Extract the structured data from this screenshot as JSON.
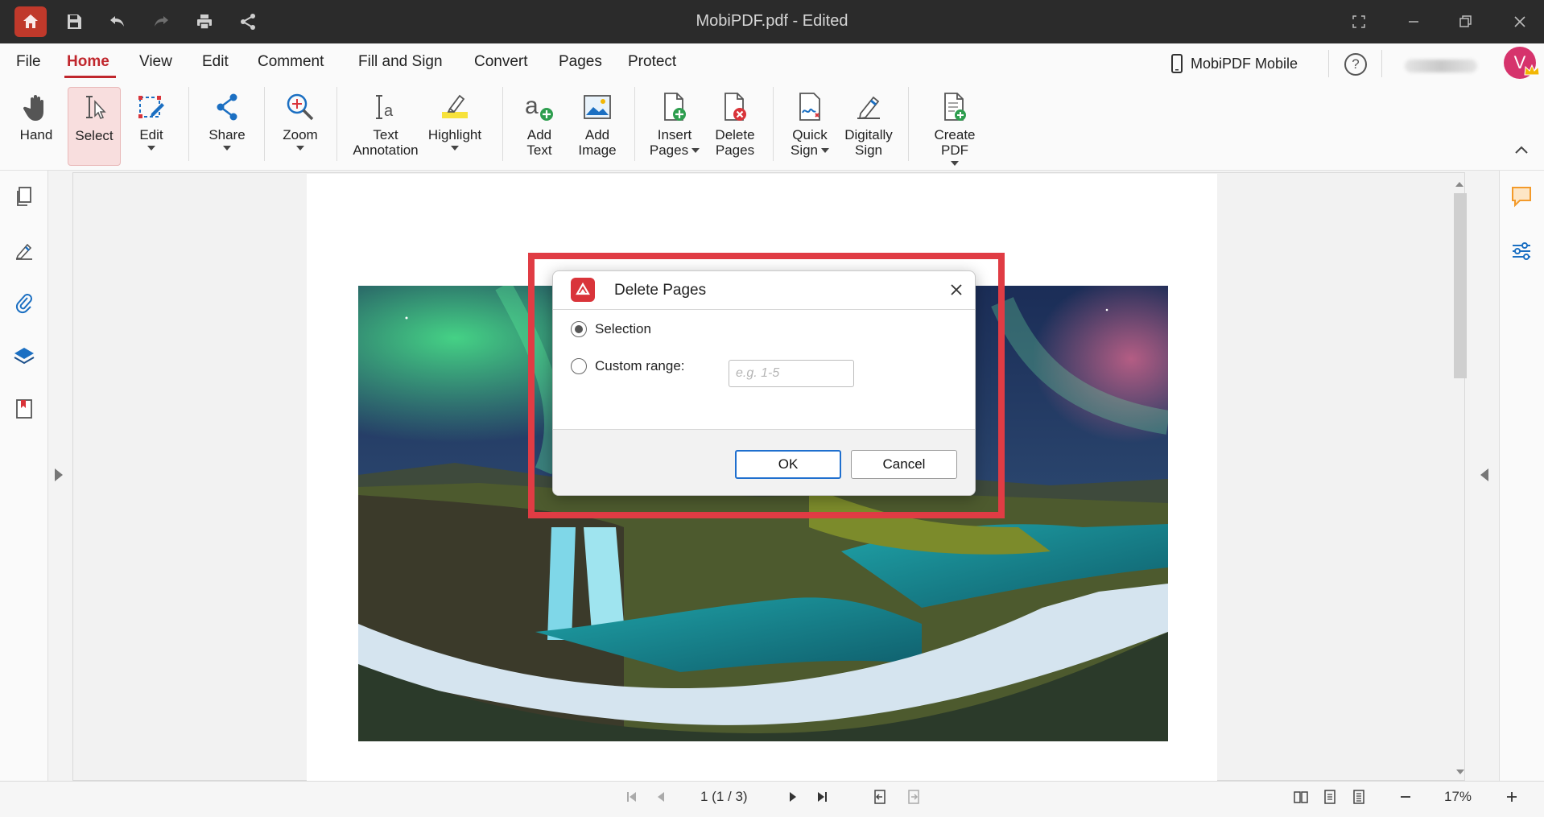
{
  "window": {
    "title": "MobiPDF.pdf - Edited"
  },
  "menu": {
    "items": [
      "File",
      "Home",
      "View",
      "Edit",
      "Comment",
      "Fill and Sign",
      "Convert",
      "Pages",
      "Protect"
    ],
    "active": "Home",
    "mobile_label": "MobiPDF Mobile",
    "help_symbol": "?",
    "avatar_letter": "V"
  },
  "ribbon": {
    "hand": "Hand",
    "select": "Select",
    "edit": "Edit",
    "share": "Share",
    "zoom": "Zoom",
    "text_annotation": "Text\nAnnotation",
    "highlight": "Highlight",
    "add_text": "Add\nText",
    "add_image": "Add\nImage",
    "insert_pages_line1": "Insert",
    "insert_pages_line2": "Pages",
    "delete_pages": "Delete\nPages",
    "quick_sign_line1": "Quick",
    "quick_sign_line2": "Sign",
    "digitally_sign": "Digitally\nSign",
    "create_pdf": "Create PDF"
  },
  "dialog": {
    "title": "Delete Pages",
    "option_selection": "Selection",
    "option_custom": "Custom range:",
    "selected_option": "Selection",
    "range_placeholder": "e.g. 1-5",
    "range_value": "",
    "ok_label": "OK",
    "cancel_label": "Cancel"
  },
  "status": {
    "page_indicator": "1 (1 / 3)",
    "zoom": "17%"
  },
  "colors": {
    "brand_red": "#c0272d",
    "highlight_frame": "#e03c44",
    "ok_border": "#1f6fce"
  },
  "icons": {
    "titlebar": [
      "home-icon",
      "save-icon",
      "undo-icon",
      "redo-icon",
      "print-icon",
      "share-icon"
    ],
    "left_sidebar": [
      "pages-icon",
      "sign-icon",
      "attachment-icon",
      "layers-icon",
      "bookmark-icon"
    ],
    "right_sidebar": [
      "comment-icon",
      "properties-icon"
    ]
  }
}
